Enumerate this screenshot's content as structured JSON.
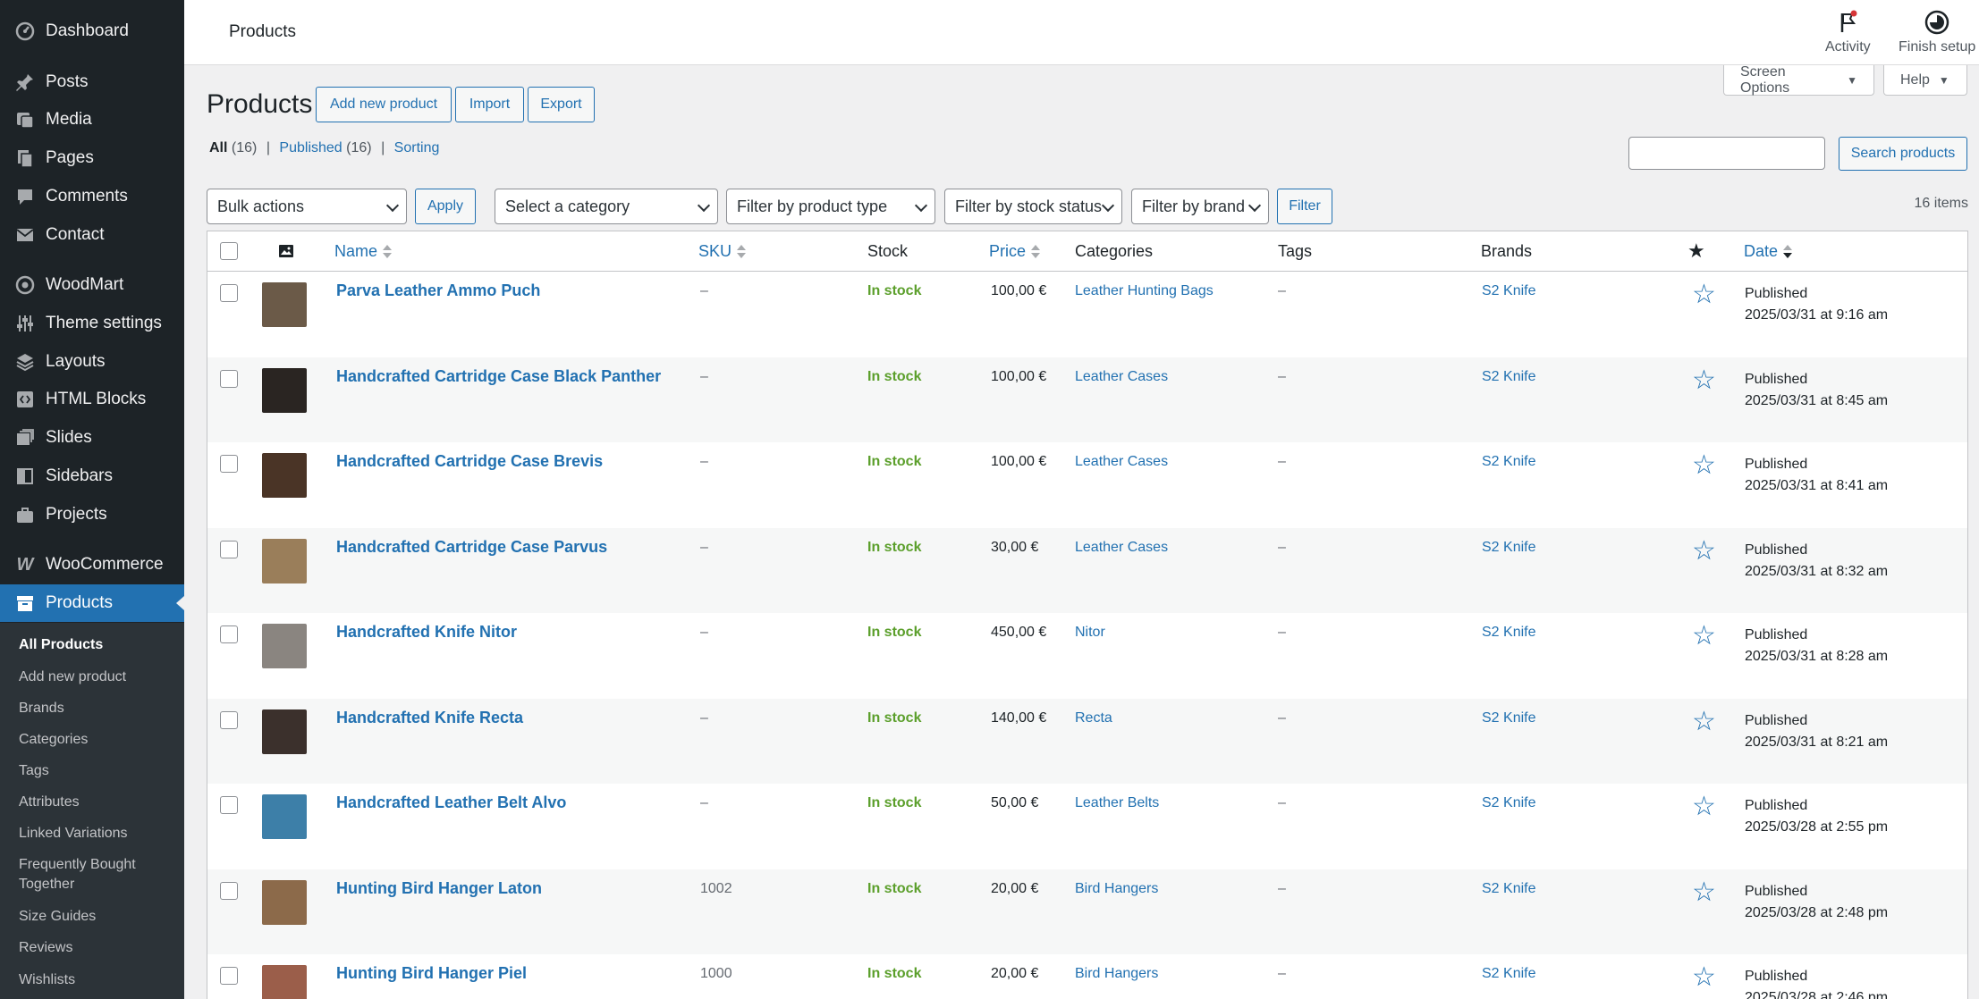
{
  "sidebar": {
    "menu": [
      {
        "label": "Dashboard",
        "icon": "dashboard-icon"
      },
      {
        "label": "Posts",
        "icon": "pin-icon"
      },
      {
        "label": "Media",
        "icon": "media-icon"
      },
      {
        "label": "Pages",
        "icon": "pages-icon"
      },
      {
        "label": "Comments",
        "icon": "comment-icon"
      },
      {
        "label": "Contact",
        "icon": "mail-icon"
      },
      {
        "label": "WoodMart",
        "icon": "woodmart-icon"
      },
      {
        "label": "Theme settings",
        "icon": "sliders-icon"
      },
      {
        "label": "Layouts",
        "icon": "layers-icon"
      },
      {
        "label": "HTML Blocks",
        "icon": "code-block-icon"
      },
      {
        "label": "Slides",
        "icon": "slides-icon"
      },
      {
        "label": "Sidebars",
        "icon": "sidebar-icon"
      },
      {
        "label": "Projects",
        "icon": "briefcase-icon"
      },
      {
        "label": "WooCommerce",
        "icon": "woocommerce-icon"
      },
      {
        "label": "Products",
        "icon": "archive-icon"
      }
    ],
    "submenu": [
      "All Products",
      "Add new product",
      "Brands",
      "Categories",
      "Tags",
      "Attributes",
      "Linked Variations",
      "Frequently Bought Together",
      "Size Guides",
      "Reviews",
      "Wishlists"
    ]
  },
  "header": {
    "title": "Products",
    "activity": "Activity",
    "finish_setup": "Finish setup"
  },
  "page": {
    "heading": "Products",
    "add_new": "Add new product",
    "import": "Import",
    "export": "Export",
    "screen_options": "Screen Options",
    "help": "Help",
    "filters": {
      "all": "All",
      "all_count": "(16)",
      "published": "Published",
      "published_count": "(16)",
      "sorting": "Sorting",
      "sep": "|"
    },
    "search_button": "Search products",
    "search_value": "",
    "bulk_actions": "Bulk actions",
    "apply": "Apply",
    "category": "Select a category",
    "product_type": "Filter by product type",
    "stock_status": "Filter by stock status",
    "brand": "Filter by brand",
    "filter": "Filter",
    "item_count": "16 items"
  },
  "table": {
    "columns": {
      "name": "Name",
      "sku": "SKU",
      "stock": "Stock",
      "price": "Price",
      "categories": "Categories",
      "tags": "Tags",
      "brands": "Brands",
      "date": "Date"
    },
    "rows": [
      {
        "name": "Parva Leather Ammo Puch",
        "sku": "–",
        "stock": "In stock",
        "price": "100,00 €",
        "category": "Leather Hunting Bags",
        "tags": "–",
        "brand": "S2 Knife",
        "status": "Published",
        "date": "2025/03/31 at 9:16 am",
        "thumb": "#6b5a48"
      },
      {
        "name": "Handcrafted Cartridge Case Black Panther",
        "sku": "–",
        "stock": "In stock",
        "price": "100,00 €",
        "category": "Leather Cases",
        "tags": "–",
        "brand": "S2 Knife",
        "status": "Published",
        "date": "2025/03/31 at 8:45 am",
        "thumb": "#2a2522"
      },
      {
        "name": "Handcrafted Cartridge Case Brevis",
        "sku": "–",
        "stock": "In stock",
        "price": "100,00 €",
        "category": "Leather Cases",
        "tags": "–",
        "brand": "S2 Knife",
        "status": "Published",
        "date": "2025/03/31 at 8:41 am",
        "thumb": "#4a3426"
      },
      {
        "name": "Handcrafted Cartridge Case Parvus",
        "sku": "–",
        "stock": "In stock",
        "price": "30,00 €",
        "category": "Leather Cases",
        "tags": "–",
        "brand": "S2 Knife",
        "status": "Published",
        "date": "2025/03/31 at 8:32 am",
        "thumb": "#9a7e5a"
      },
      {
        "name": "Handcrafted Knife Nitor",
        "sku": "–",
        "stock": "In stock",
        "price": "450,00 €",
        "category": "Nitor",
        "tags": "–",
        "brand": "S2 Knife",
        "status": "Published",
        "date": "2025/03/31 at 8:28 am",
        "thumb": "#8a8580"
      },
      {
        "name": "Handcrafted Knife Recta",
        "sku": "–",
        "stock": "In stock",
        "price": "140,00 €",
        "category": "Recta",
        "tags": "–",
        "brand": "S2 Knife",
        "status": "Published",
        "date": "2025/03/31 at 8:21 am",
        "thumb": "#3b302c"
      },
      {
        "name": "Handcrafted Leather Belt Alvo",
        "sku": "–",
        "stock": "In stock",
        "price": "50,00 €",
        "category": "Leather Belts",
        "tags": "–",
        "brand": "S2 Knife",
        "status": "Published",
        "date": "2025/03/28 at 2:55 pm",
        "thumb": "#3d7fa8"
      },
      {
        "name": "Hunting Bird Hanger Laton",
        "sku": "1002",
        "stock": "In stock",
        "price": "20,00 €",
        "category": "Bird Hangers",
        "tags": "–",
        "brand": "S2 Knife",
        "status": "Published",
        "date": "2025/03/28 at 2:48 pm",
        "thumb": "#8c6a4a"
      },
      {
        "name": "Hunting Bird Hanger Piel",
        "sku": "1000",
        "stock": "In stock",
        "price": "20,00 €",
        "category": "Bird Hangers",
        "tags": "–",
        "brand": "S2 Knife",
        "status": "Published",
        "date": "2025/03/28 at 2:46 pm",
        "thumb": "#9b5e4a"
      }
    ]
  },
  "colors": {
    "sidebar_bg": "#1d2327",
    "accent": "#2271b1",
    "in_stock": "#5b9f2b"
  }
}
